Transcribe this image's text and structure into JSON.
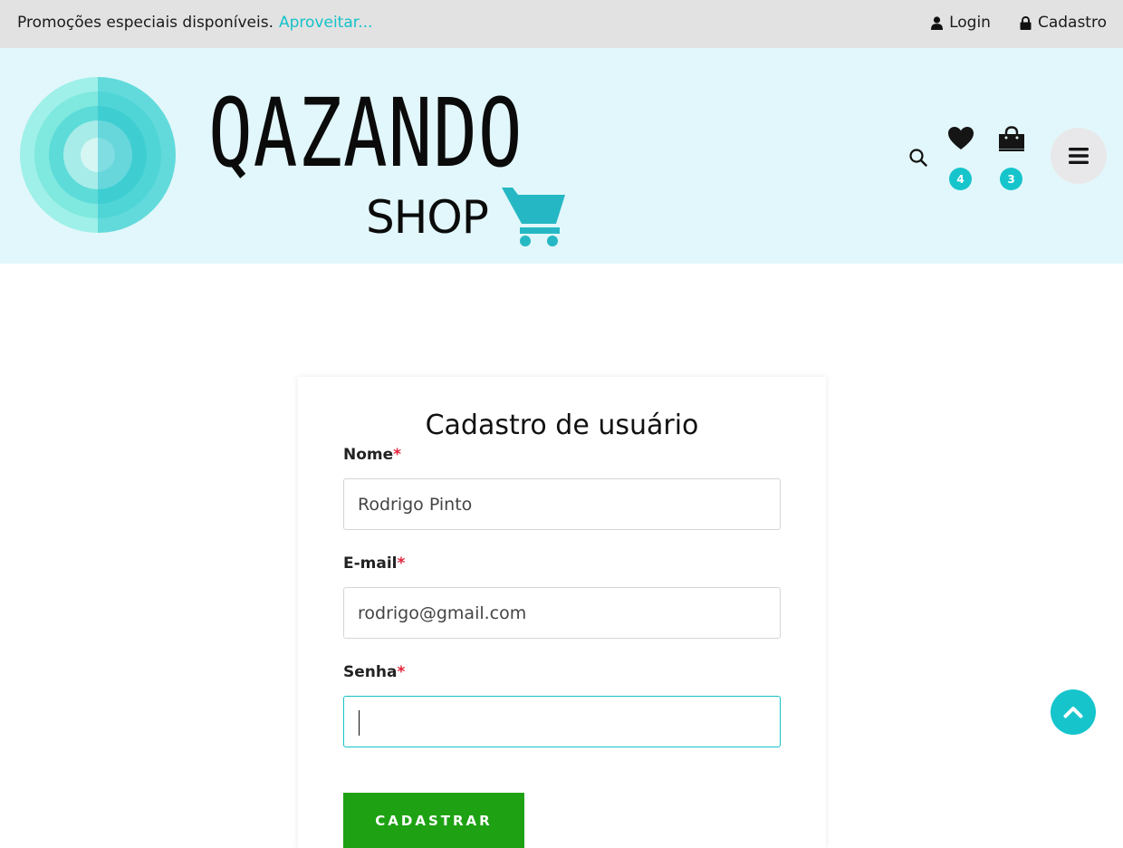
{
  "topbar": {
    "promo_text": "Promoções especiais disponíveis.",
    "promo_link": "Aproveitar...",
    "login_label": "Login",
    "register_label": "Cadastro"
  },
  "header": {
    "logo_brand": "QAZANDO",
    "logo_sub": "SHOP",
    "wishlist_count": "4",
    "cart_count": "3",
    "icons": [
      "search-icon",
      "heart-icon",
      "shopping-bag-icon",
      "hamburger-menu-icon"
    ]
  },
  "form": {
    "title": "Cadastro de usuário",
    "required_mark": "*",
    "name_label": "Nome",
    "name_value": "Rodrigo Pinto",
    "email_label": "E-mail",
    "email_value": "rodrigo@gmail.com",
    "password_label": "Senha",
    "password_value": "",
    "submit_label": "CADASTRAR"
  },
  "colors": {
    "accent": "#16c5cc",
    "submit": "#1ea214",
    "header_bg": "#e2f7fb",
    "topbar_bg": "#e2e2e2",
    "required": "#e3253b"
  }
}
